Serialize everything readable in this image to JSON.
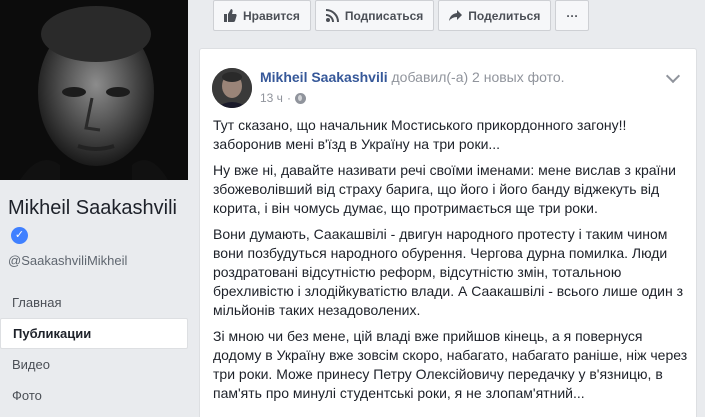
{
  "profile": {
    "name": "Mikheil Saakashvili",
    "handle": "@SaakashviliMikheil"
  },
  "nav": [
    {
      "label": "Главная"
    },
    {
      "label": "Публикации"
    },
    {
      "label": "Видео"
    },
    {
      "label": "Фото"
    }
  ],
  "actions": {
    "like": "Нравится",
    "subscribe": "Подписаться",
    "share": "Поделиться",
    "more": "···"
  },
  "post": {
    "author": "Mikheil Saakashvili",
    "action": "добавил(-а) 2 новых фото.",
    "time": "13 ч",
    "separator": "·",
    "paragraphs": [
      "Тут сказано, що начальник Мостиського прикордонного загону!! заборонив мені в'їзд в Україну на три роки...",
      "Ну вже ні, давайте називати речі своїми іменами: мене вислав з країни збожеволівший від страху барига, що його і його банду віджекуть від корита, і він чомусь думає, що протримається ще три роки.",
      "Вони думають, Саакашвілі - двигун народного протесту і таким чином вони позбудуться народного обурення. Чергова дурна помилка. Люди роздратовані відсутністю реформ, відсутністю змін, тотальною брехливістю і злодійкуватістю влади. А Саакашвілі - всього лише один з мільйонів таких незадоволених.",
      "Зі мною чи без мене, цій владі вже прийшов кінець, а я повернуся додому в Україну вже зовсім скоро, набагато, набагато раніше, ніж через три роки. Може принесу Петру Олексійовичу передачку у в'язницю, в пам'ять про минулі студентські роки, я не злопам'ятний..."
    ],
    "trailing": "—"
  },
  "colors": {
    "link": "#365899",
    "verified": "#4080ff",
    "background": "#e9ebee"
  }
}
